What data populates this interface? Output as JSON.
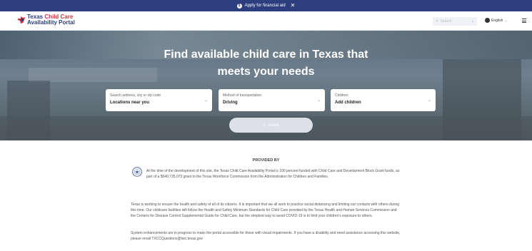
{
  "announcement": {
    "text": "Apply for financial aid",
    "close_glyph": "✕"
  },
  "header": {
    "logo": {
      "line1_part1": "Texas ",
      "line1_part2": "Child Care",
      "line2": "Availability Portal"
    },
    "search": {
      "placeholder": "Search"
    },
    "language": {
      "label": "English"
    },
    "icons": [
      "logo-icon",
      "search-icon",
      "globe-icon",
      "chevron-down-icon",
      "hamburger-menu-icon"
    ]
  },
  "hero": {
    "title_line1": "Find available child care in Texas that",
    "title_line2": "meets your needs",
    "fields": [
      {
        "label": "Search address, city or zip code",
        "value": "Locations near you"
      },
      {
        "label": "Method of transportation",
        "value": "Driving"
      },
      {
        "label": "Children",
        "value": "Add children"
      }
    ],
    "submit_label": "Submit"
  },
  "provided": {
    "heading": "PROVIDED BY",
    "paragraph1": "At the time of the development of this site, the Texas Child Care Availability Portal is 100 percent funded with Child Care and Development Block Grant funds, as part of a $540,735,073 grant to the Texas Workforce Commission from the Administration for Children and Families.",
    "paragraph2": "Texas is working to ensure the health and safety of all of its citizens. It is important that we all work to practice social distancing and limiting our contacts with others during this time. Our childcare facilities will follow the Health and Safety Minimum Standards for Child Care provided by the Texas Health and Human Services Commission and the Centers for Disease Control Supplemental Guide for Child Care, but the simplest way to avoid COVID-19 is to limit your children's exposure to others.",
    "paragraph3": "System enhancements are in progress to make the portal accessible for those with visual impairments. If you have a disability and need assistance accessing this website, please email TXCCQuestions@twc.texas.gov"
  },
  "colors": {
    "brand_blue": "#2c3e7d",
    "brand_red": "#d6333a",
    "submit_disabled": "#dde1e6"
  }
}
